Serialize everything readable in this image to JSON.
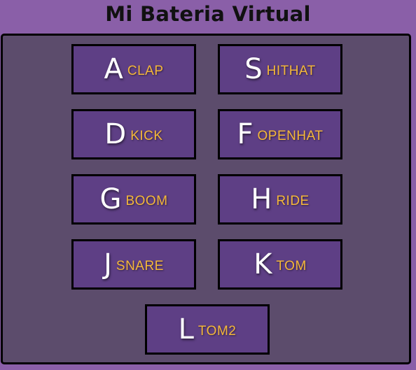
{
  "app": {
    "title": "Mi Bateria Virtual"
  },
  "colors": {
    "background": "#8a5fa8",
    "panel": "#5c4c6c",
    "pad": "#5e3f85",
    "key_text": "#ffffff",
    "sound_text": "#f4b73a",
    "border": "#000000"
  },
  "pads": [
    {
      "key": "A",
      "sound": "CLAP"
    },
    {
      "key": "S",
      "sound": "HITHAT"
    },
    {
      "key": "D",
      "sound": "KICK"
    },
    {
      "key": "F",
      "sound": "OPENHAT"
    },
    {
      "key": "G",
      "sound": "BOOM"
    },
    {
      "key": "H",
      "sound": "RIDE"
    },
    {
      "key": "J",
      "sound": "SNARE"
    },
    {
      "key": "K",
      "sound": "TOM"
    },
    {
      "key": "L",
      "sound": "TOM2"
    }
  ]
}
